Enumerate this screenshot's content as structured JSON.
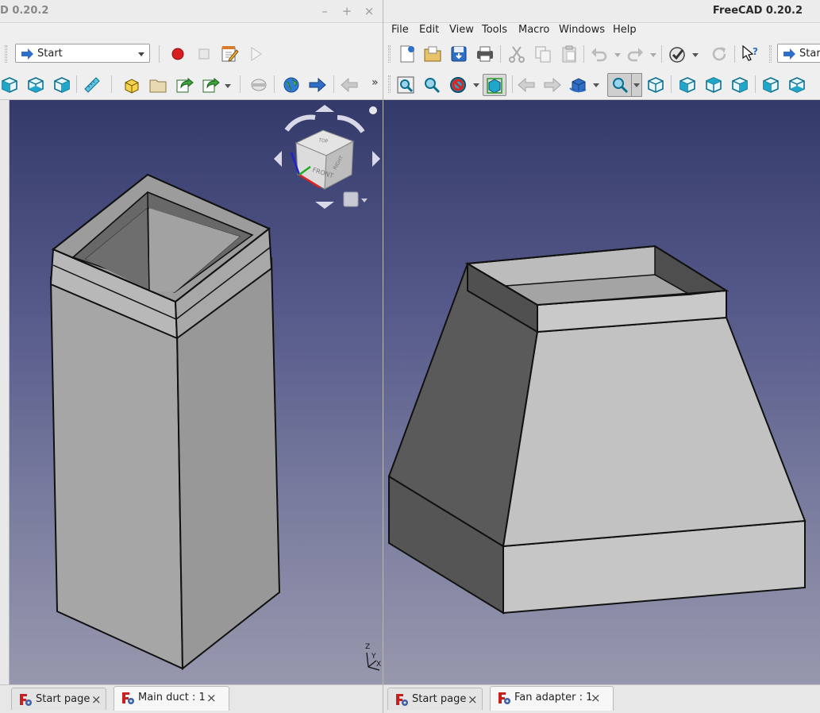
{
  "windows": {
    "left": {
      "title": "D 0.20.2",
      "workbench": "Start",
      "tabs": [
        {
          "label": "Start page",
          "active": false
        },
        {
          "label": "Main duct : 1",
          "active": true
        }
      ]
    },
    "right": {
      "title": "FreeCAD 0.20.2",
      "workbench": "Start",
      "menu": [
        "File",
        "Edit",
        "View",
        "Tools",
        "Macro",
        "Windows",
        "Help"
      ],
      "tabs": [
        {
          "label": "Start page",
          "active": false
        },
        {
          "label": "Fan adapter : 1",
          "active": true
        }
      ]
    }
  },
  "window_controls": {
    "minimize": "–",
    "maximize": "+",
    "close": "×"
  },
  "navcube": {
    "front_label": "FRONT",
    "top_label": "TOP",
    "right_label": "RIGHT"
  },
  "axis": {
    "x": "X",
    "y": "Y",
    "z": "Z"
  },
  "overflow_indicator": "»",
  "tab_close": "×",
  "colors": {
    "accent_blue": "#2f6fc8",
    "record_red": "#d81e1e",
    "model_light": "#c6c6c6",
    "model_mid": "#a9a9a9",
    "model_dark": "#5a5a5a",
    "viewport_top": "#333a6a",
    "viewport_bottom": "#9798ad"
  }
}
